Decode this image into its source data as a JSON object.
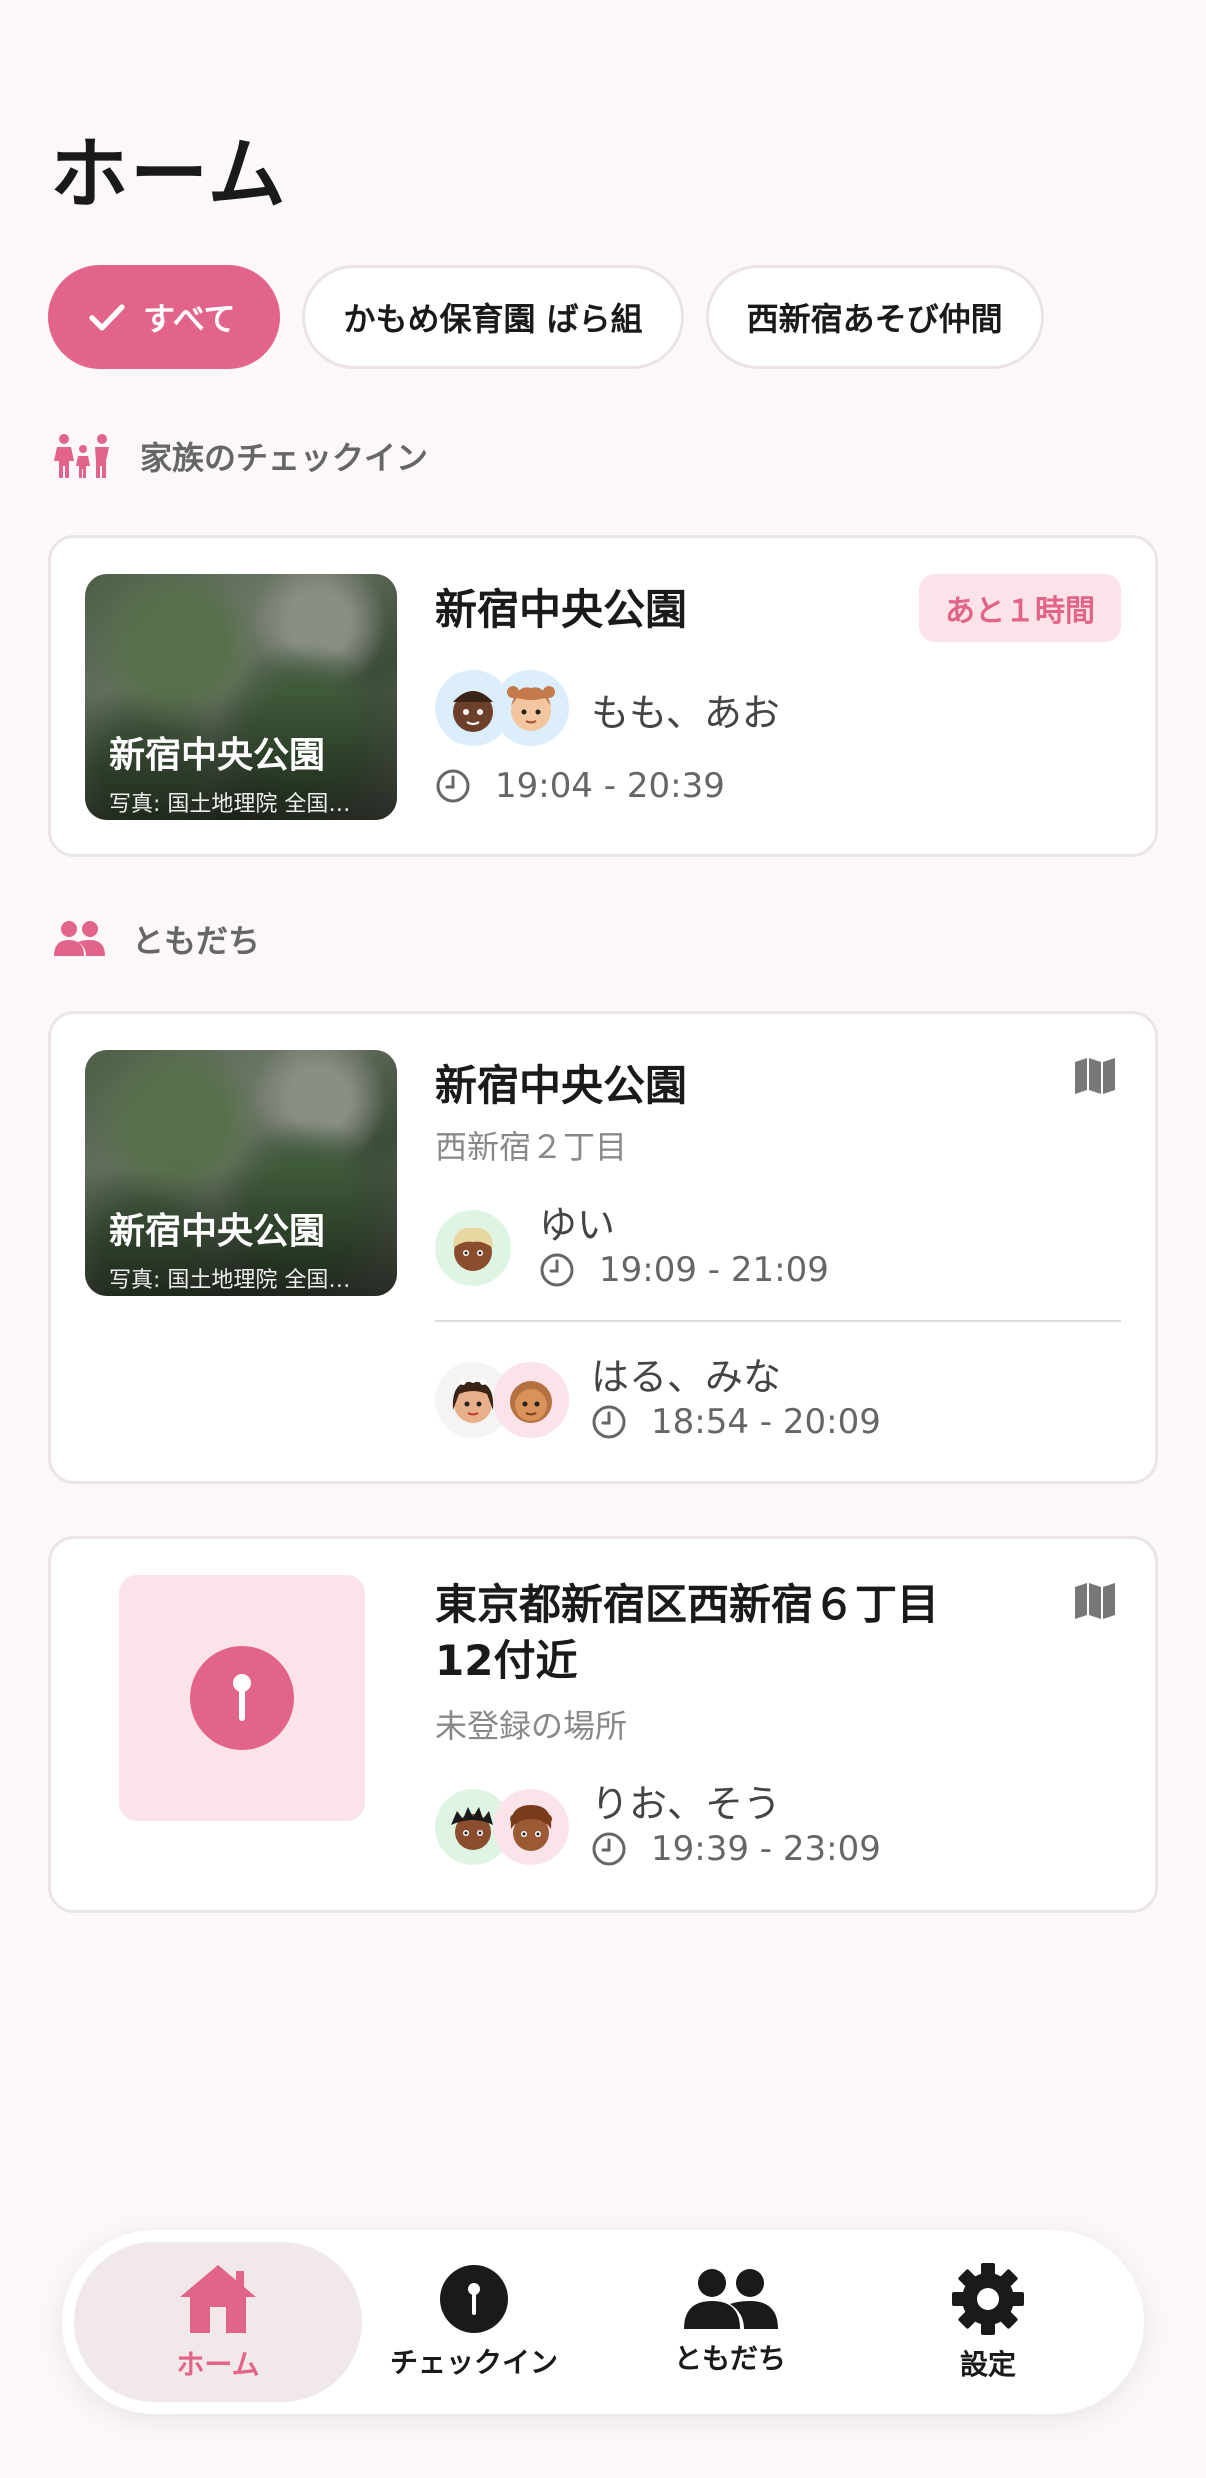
{
  "page": {
    "title": "ホーム"
  },
  "filters": [
    {
      "label": "すべて",
      "selected": true
    },
    {
      "label": "かもめ保育園 ばら組",
      "selected": false
    },
    {
      "label": "西新宿あそび仲間",
      "selected": false
    }
  ],
  "family": {
    "section_title": "家族のチェックイン",
    "card": {
      "place": "新宿中央公園",
      "thumb_label": "新宿中央公園",
      "thumb_credit": "写真: 国土地理院 全国最新写真",
      "badge": "あと１時間",
      "names": "もも、あお",
      "time": "19:04 - 20:39"
    }
  },
  "friends": {
    "section_title": "ともだち",
    "cards": [
      {
        "place": "新宿中央公園",
        "subtitle": "西新宿２丁目",
        "thumb_label": "新宿中央公園",
        "thumb_credit": "写真: 国土地理院 全国最新写真",
        "groups": [
          {
            "names": "ゆい",
            "time": "19:09 - 21:09"
          },
          {
            "names": "はる、みな",
            "time": "18:54 - 20:09"
          }
        ]
      },
      {
        "place": "東京都新宿区西新宿６丁目12付近",
        "subtitle": "未登録の場所",
        "groups": [
          {
            "names": "りお、そう",
            "time": "19:39 - 23:09"
          }
        ]
      }
    ]
  },
  "tabbar": {
    "home": "ホーム",
    "checkin": "チェックイン",
    "friends": "ともだち",
    "settings": "設定"
  },
  "colors": {
    "accent": "#e2648a",
    "accent_light": "#fbe3ea",
    "background": "#fcf7f8"
  }
}
